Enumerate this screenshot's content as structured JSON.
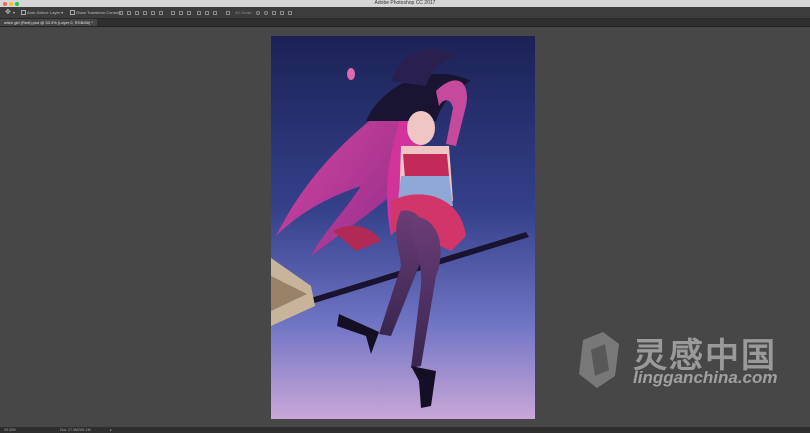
{
  "window": {
    "title": "Adobe Photoshop CC 2017",
    "controls": {
      "close_color": "#ff5f57",
      "minimize_color": "#febc2e",
      "zoom_color": "#28c840"
    }
  },
  "options_bar": {
    "tool_icon": "move-tool-icon",
    "auto_select_label": "Auto-Select:",
    "auto_select_value": "Layer",
    "show_transform_controls_label": "Show Transform Controls",
    "mode_3d_label": "3D Mode:"
  },
  "document_tab": {
    "label": "witch girl (Reel).psd @ 33.3% (Layer 0, RGB/8#) *"
  },
  "status_bar": {
    "zoom": "33.33%",
    "doc_info": "Doc: 27.9M/391.1M"
  },
  "watermark": {
    "cn_text": "灵感中国",
    "url": "lingganchina.com"
  },
  "colors": {
    "canvas_bg": "#474747",
    "art_sky_top": "#1f2557",
    "art_sky_bottom": "#c8a8d8",
    "hair_pink": "#e0409e"
  }
}
